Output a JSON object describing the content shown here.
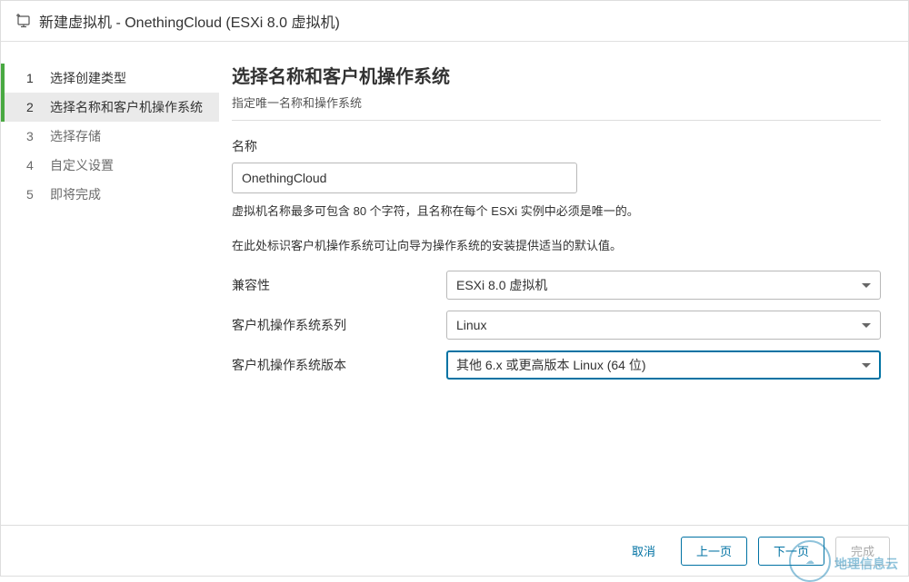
{
  "titlebar": {
    "title": "新建虚拟机 - OnethingCloud (ESXi 8.0 虚拟机)"
  },
  "sidebar": {
    "steps": [
      {
        "num": "1",
        "label": "选择创建类型"
      },
      {
        "num": "2",
        "label": "选择名称和客户机操作系统"
      },
      {
        "num": "3",
        "label": "选择存储"
      },
      {
        "num": "4",
        "label": "自定义设置"
      },
      {
        "num": "5",
        "label": "即将完成"
      }
    ]
  },
  "main": {
    "heading": "选择名称和客户机操作系统",
    "subtitle": "指定唯一名称和操作系统",
    "name_label": "名称",
    "name_value": "OnethingCloud",
    "helper1": "虚拟机名称最多可包含 80 个字符，且名称在每个 ESXi 实例中必须是唯一的。",
    "helper2": "在此处标识客户机操作系统可让向导为操作系统的安装提供适当的默认值。",
    "rows": {
      "compat_label": "兼容性",
      "compat_value": "ESXi 8.0 虚拟机",
      "family_label": "客户机操作系统系列",
      "family_value": "Linux",
      "version_label": "客户机操作系统版本",
      "version_value": "其他 6.x 或更高版本 Linux (64 位)"
    }
  },
  "footer": {
    "cancel": "取消",
    "back": "上一页",
    "next": "下一页",
    "finish": "完成"
  },
  "watermark": {
    "text": "地理信息云"
  }
}
